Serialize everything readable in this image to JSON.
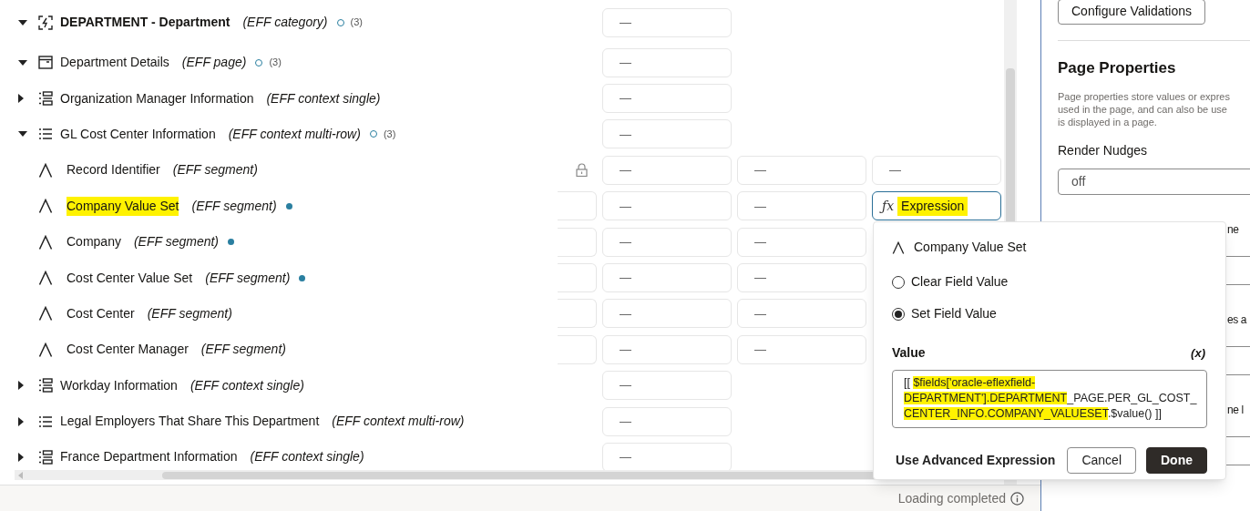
{
  "tree": {
    "rows": [
      {
        "kind": "category",
        "expanded": true,
        "label": "DEPARTMENT - Department",
        "type": "(EFF category)",
        "indicator_filled": false,
        "count": "(3)",
        "cells": [
          "—"
        ]
      },
      {
        "kind": "page",
        "expanded": true,
        "label": "Department Details",
        "type": "(EFF page)",
        "indicator_filled": false,
        "count": "(3)",
        "cells": [
          "—"
        ]
      },
      {
        "kind": "context_single",
        "expanded": false,
        "label": "Organization Manager Information",
        "type": "(EFF context single)",
        "cells": [
          "—"
        ]
      },
      {
        "kind": "context_multi",
        "expanded": true,
        "label": "GL Cost Center Information",
        "type": "(EFF context multi-row)",
        "indicator_filled": false,
        "count": "(3)",
        "cells": [
          "—"
        ]
      },
      {
        "kind": "segment",
        "label": "Record Identifier",
        "type": "(EFF segment)",
        "locked": true,
        "cells": [
          "—",
          "—",
          "—"
        ]
      },
      {
        "kind": "segment",
        "label": "Company Value Set",
        "type": "(EFF segment)",
        "highlighted": true,
        "indicator_filled": true,
        "leading_cell": true,
        "cells": [
          "—",
          "—"
        ],
        "expression": {
          "icon": "ƒx",
          "text": "Expression",
          "focused": true,
          "highlighted": true
        }
      },
      {
        "kind": "segment",
        "label": "Company",
        "type": "(EFF segment)",
        "indicator_filled": true,
        "leading_cell": true,
        "cells": [
          "—",
          "—"
        ]
      },
      {
        "kind": "segment",
        "label": "Cost Center Value Set",
        "type": "(EFF segment)",
        "indicator_filled": true,
        "leading_cell": true,
        "cells": [
          "—",
          "—"
        ]
      },
      {
        "kind": "segment",
        "label": "Cost Center",
        "type": "(EFF segment)",
        "leading_cell": true,
        "cells": [
          "—",
          "—"
        ]
      },
      {
        "kind": "segment",
        "label": "Cost Center Manager",
        "type": "(EFF segment)",
        "leading_cell": true,
        "cells": [
          "—",
          "—"
        ]
      },
      {
        "kind": "context_single",
        "expanded": false,
        "label": "Workday Information",
        "type": "(EFF context single)",
        "cells": [
          "—"
        ]
      },
      {
        "kind": "context_multi",
        "expanded": false,
        "label": "Legal Employers That Share This Department",
        "type": "(EFF context multi-row)",
        "cells": [
          "—"
        ]
      },
      {
        "kind": "context_single",
        "expanded": false,
        "label": "France Department Information",
        "type": "(EFF context single)",
        "cells": [
          "—"
        ]
      }
    ]
  },
  "status_bar": {
    "text": "Loading completed"
  },
  "right_panel": {
    "configure_button": "Configure Validations",
    "heading": "Page Properties",
    "description_lines": [
      "Page properties store values or expres",
      "used in the page, and can also be use",
      "is displayed in a page."
    ],
    "fields": [
      {
        "label": "Render Nudges",
        "value": "off"
      },
      {
        "label": "ne"
      },
      {
        "label": "es a"
      },
      {
        "label": "ne l"
      }
    ]
  },
  "popup": {
    "title": "Company Value Set",
    "options": [
      {
        "label": "Clear Field Value",
        "selected": false
      },
      {
        "label": "Set Field Value",
        "selected": true
      }
    ],
    "value_label": "Value",
    "variable_toggle": "(x)",
    "value_segments": [
      {
        "text": "[[ ",
        "highlighted": false
      },
      {
        "text": "$fields['oracle-eflexfield-DEPARTMENT'].DEPARTMENT",
        "highlighted": true
      },
      {
        "text": "_PAGE.PER_GL_COST_",
        "highlighted": false
      },
      {
        "text": "CENTER_INFO.COMPANY_VALUESET",
        "highlighted": true
      },
      {
        "text": ".$value() ]]",
        "highlighted": false
      }
    ],
    "advanced_link": "Use Advanced Expression",
    "buttons": [
      {
        "label": "Cancel",
        "kind": "secondary"
      },
      {
        "label": "Done",
        "kind": "primary"
      }
    ]
  }
}
